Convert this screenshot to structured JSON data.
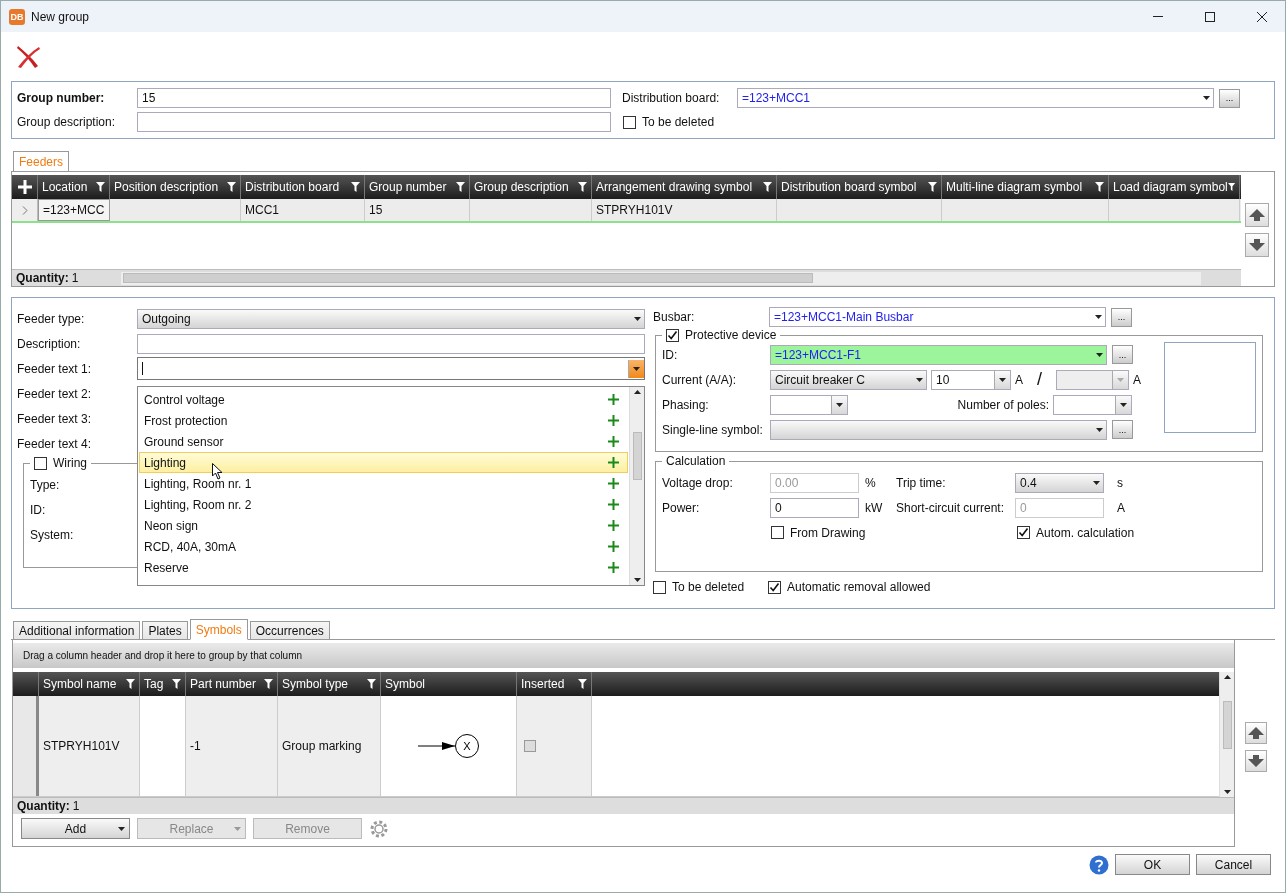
{
  "window": {
    "logo": "DB",
    "title": "New group"
  },
  "group": {
    "number": {
      "label": "Group number:",
      "value": "15"
    },
    "description": {
      "label": "Group description:"
    },
    "board": {
      "label": "Distribution board:",
      "value": "=123+MCC1",
      "browse": "..."
    },
    "to_be_deleted": {
      "label": "To be deleted",
      "checked": false
    }
  },
  "feeders": {
    "tab": {
      "label": "Feeders",
      "selected": true
    },
    "columns": [
      {
        "label": "Location",
        "filter": true
      },
      {
        "label": "Position description",
        "filter": true
      },
      {
        "label": "Distribution board",
        "filter": true
      },
      {
        "label": "Group number",
        "filter": true
      },
      {
        "label": "Group description",
        "filter": true
      },
      {
        "label": "Arrangement drawing symbol",
        "filter": true
      },
      {
        "label": "Distribution board symbol",
        "filter": true
      },
      {
        "label": "Multi-line diagram symbol",
        "filter": true
      },
      {
        "label": "Load diagram symbol",
        "filter": true
      }
    ],
    "rows": [
      {
        "cells": [
          "=123+MCC",
          null,
          "MCC1",
          "15",
          null,
          "STPRYH101V",
          null,
          null,
          null
        ],
        "selected": true
      }
    ],
    "quantity": {
      "label": "Quantity:",
      "value": "1"
    }
  },
  "feeder": {
    "type": {
      "label": "Feeder type:",
      "value": "Outgoing"
    },
    "description": {
      "label": "Description:"
    },
    "texts": [
      {
        "label": "Feeder text 1:",
        "open": true
      },
      {
        "label": "Feeder text 2:",
        "open": false
      },
      {
        "label": "Feeder text 3:",
        "open": false
      },
      {
        "label": "Feeder text 4:",
        "open": false
      }
    ],
    "dropdown": [
      {
        "label": "Control voltage",
        "selected": false
      },
      {
        "label": "Frost protection",
        "selected": false
      },
      {
        "label": "Ground sensor",
        "selected": false
      },
      {
        "label": "Lighting",
        "selected": true
      },
      {
        "label": "Lighting, Room nr. 1",
        "selected": false
      },
      {
        "label": "Lighting, Room nr. 2",
        "selected": false
      },
      {
        "label": "Neon sign",
        "selected": false
      },
      {
        "label": "RCD, 40A, 30mA",
        "selected": false
      },
      {
        "label": "Reserve",
        "selected": false
      }
    ],
    "wiring": {
      "label": "Wiring",
      "checked": false,
      "fields": [
        {
          "label": "Type:"
        },
        {
          "label": "ID:"
        },
        {
          "label": "System:"
        }
      ]
    },
    "busbar": {
      "label": "Busbar:",
      "value": "=123+MCC1-Main Busbar",
      "browse": "..."
    },
    "protective_device": {
      "label": "Protective device",
      "checked": true,
      "id": {
        "label": "ID:",
        "value": "=123+MCC1-F1",
        "browse": "..."
      },
      "current": {
        "label": "Current (A/A):",
        "type": "Circuit breaker C",
        "value": "10",
        "unit": "A",
        "separator": "/",
        "unit2": "A"
      },
      "phasing": {
        "label": "Phasing:"
      },
      "poles": {
        "label": "Number of poles:"
      },
      "single_line_symbol": {
        "label": "Single-line symbol:",
        "browse": "..."
      }
    },
    "calculation": {
      "label": "Calculation",
      "voltage_drop": {
        "label": "Voltage drop:",
        "value": "0.00",
        "unit": "%",
        "disabled": true
      },
      "trip_time": {
        "label": "Trip time:",
        "value": "0.4",
        "unit": "s"
      },
      "power": {
        "label": "Power:",
        "value": "0",
        "unit": "kW",
        "disabled": false
      },
      "short_circuit": {
        "label": "Short-circuit current:",
        "value": "0",
        "unit": "A",
        "disabled": true
      },
      "from_drawing": {
        "label": "From Drawing",
        "checked": false
      },
      "auto": {
        "label": "Autom. calculation",
        "checked": true
      }
    },
    "to_be_deleted": {
      "label": "To be deleted",
      "checked": false
    },
    "automatic_removal": {
      "label": "Automatic removal allowed",
      "checked": true
    }
  },
  "tabs": [
    {
      "label": "Additional information",
      "selected": false
    },
    {
      "label": "Plates",
      "selected": false
    },
    {
      "label": "Symbols",
      "selected": true
    },
    {
      "label": "Occurrences",
      "selected": false
    }
  ],
  "symbols": {
    "hint": "Drag a column header and drop it here to group by that column",
    "columns": [
      {
        "label": "Symbol name",
        "filter": true
      },
      {
        "label": "Tag",
        "filter": true
      },
      {
        "label": "Part number",
        "filter": true
      },
      {
        "label": "Symbol type",
        "filter": true
      },
      {
        "label": "Symbol",
        "filter": false
      },
      {
        "label": "Inserted",
        "filter": true
      }
    ],
    "rows": [
      {
        "cells": [
          "STPRYH101V",
          null,
          "-1",
          "Group marking"
        ],
        "symbol": "X",
        "inserted": false
      }
    ],
    "quantity": {
      "label": "Quantity:",
      "value": "1"
    },
    "buttons": [
      {
        "label": "Add",
        "menu": true,
        "disabled": false
      },
      {
        "label": "Replace",
        "menu": true,
        "disabled": true
      },
      {
        "label": "Remove",
        "menu": false,
        "disabled": true
      }
    ]
  },
  "footer": {
    "buttons": [
      {
        "label": "OK"
      },
      {
        "label": "Cancel"
      }
    ]
  }
}
